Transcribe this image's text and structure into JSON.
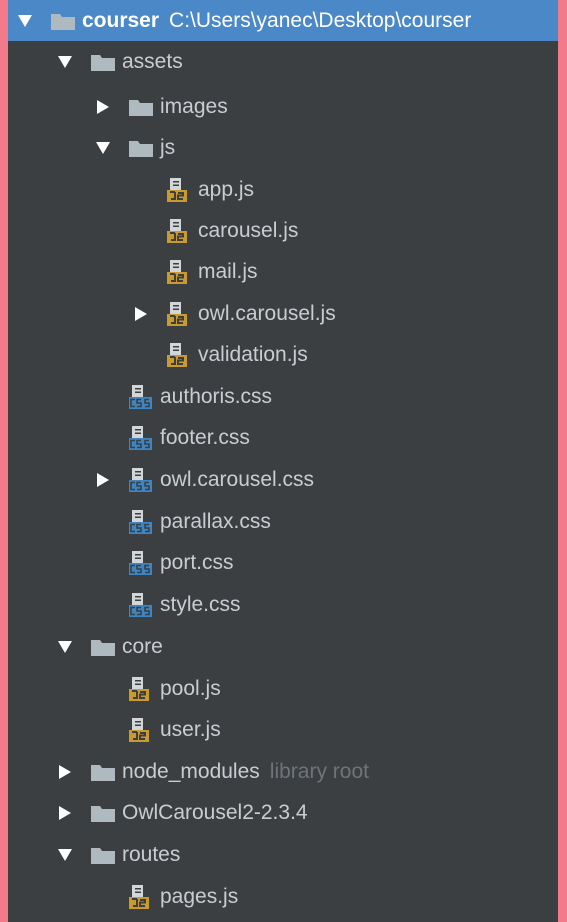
{
  "tree": {
    "root": {
      "label": "courser",
      "path": "C:\\Users\\yanec\\Desktop\\courser",
      "expanded": true
    },
    "items": [
      {
        "id": "assets",
        "label": "assets",
        "kind": "folder",
        "expanded": true
      },
      {
        "id": "images",
        "label": "images",
        "kind": "folder",
        "expanded": false
      },
      {
        "id": "js",
        "label": "js",
        "kind": "folder",
        "expanded": true
      },
      {
        "id": "app-js",
        "label": "app.js",
        "kind": "js-file"
      },
      {
        "id": "carousel-js",
        "label": "carousel.js",
        "kind": "js-file"
      },
      {
        "id": "mail-js",
        "label": "mail.js",
        "kind": "js-file"
      },
      {
        "id": "owl-carousel-js",
        "label": "owl.carousel.js",
        "kind": "js-file",
        "expandable": true
      },
      {
        "id": "validation-js",
        "label": "validation.js",
        "kind": "js-file"
      },
      {
        "id": "authoris-css",
        "label": "authoris.css",
        "kind": "css-file"
      },
      {
        "id": "footer-css",
        "label": "footer.css",
        "kind": "css-file"
      },
      {
        "id": "owl-carousel-css",
        "label": "owl.carousel.css",
        "kind": "css-file",
        "expandable": true
      },
      {
        "id": "parallax-css",
        "label": "parallax.css",
        "kind": "css-file"
      },
      {
        "id": "port-css",
        "label": "port.css",
        "kind": "css-file"
      },
      {
        "id": "style-css",
        "label": "style.css",
        "kind": "css-file"
      },
      {
        "id": "core",
        "label": "core",
        "kind": "folder",
        "expanded": true
      },
      {
        "id": "pool-js",
        "label": "pool.js",
        "kind": "js-file"
      },
      {
        "id": "user-js",
        "label": "user.js",
        "kind": "js-file"
      },
      {
        "id": "node-modules",
        "label": "node_modules",
        "kind": "folder",
        "expanded": false,
        "hint": "library root"
      },
      {
        "id": "owlcarousel2",
        "label": "OwlCarousel2-2.3.4",
        "kind": "folder",
        "expanded": false
      },
      {
        "id": "routes",
        "label": "routes",
        "kind": "folder",
        "expanded": true
      },
      {
        "id": "pages-js",
        "label": "pages.js",
        "kind": "js-file"
      }
    ]
  },
  "colors": {
    "panel": "#3c3f41",
    "selection": "#4a88c7",
    "folder": "#aeb9c0",
    "js_badge": "#c99a2e",
    "css_badge": "#3d86c6",
    "hint": "#6f7478",
    "frame": "#f27a8a"
  },
  "icons": {
    "folder": "folder-icon",
    "js-file": "js-file-icon",
    "css-file": "css-file-icon",
    "expanded": "chevron-down-icon",
    "collapsed": "chevron-right-icon"
  }
}
